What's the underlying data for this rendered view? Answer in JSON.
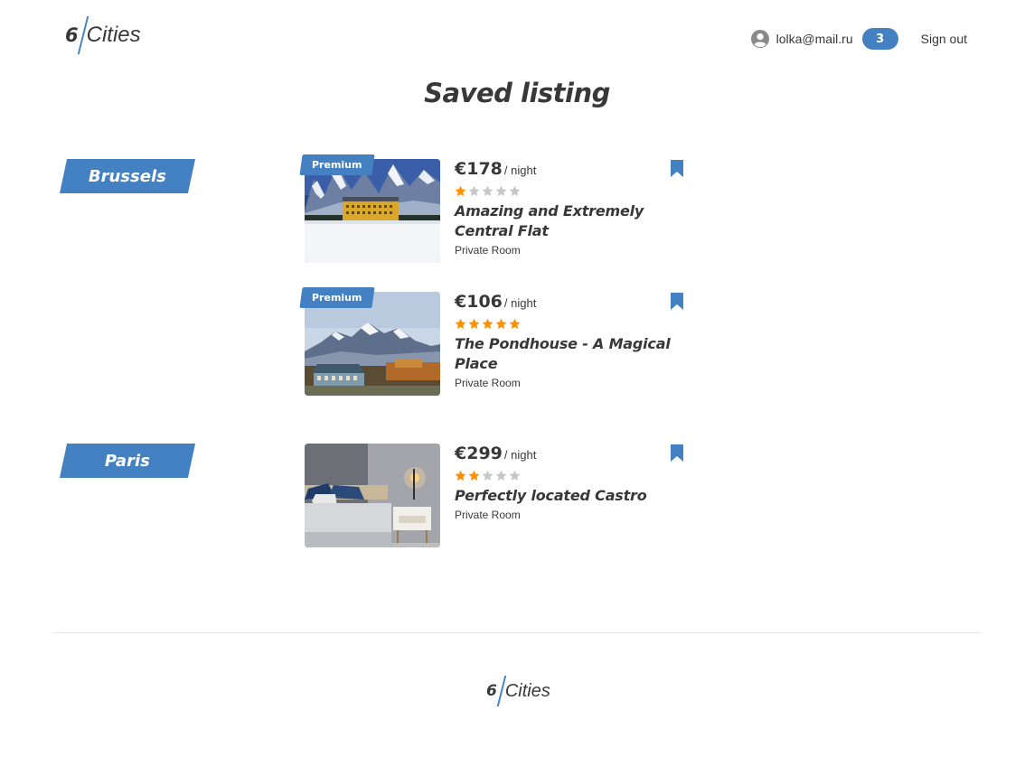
{
  "header": {
    "logo_six": "6",
    "logo_cities": "Cities",
    "user_email": "lolka@mail.ru",
    "favorites_count": "3",
    "sign_out": "Sign out"
  },
  "page": {
    "title": "Saved listing"
  },
  "colors": {
    "accent": "#4481c3",
    "star_active": "#ff9000",
    "star_inactive": "#c7c7c7",
    "text": "#383838"
  },
  "groups": [
    {
      "city": "Brussels",
      "cards": [
        {
          "premium_label": "Premium",
          "price": "€178",
          "per_night": "/ night",
          "rating": 1,
          "name": "Amazing and Extremely Central Flat",
          "type": "Private Room",
          "image": "mountain-hotel-snow"
        },
        {
          "premium_label": "Premium",
          "price": "€106",
          "per_night": "/ night",
          "rating": 5,
          "name": "The Pondhouse - A Magical Place",
          "type": "Private Room",
          "image": "mountain-house-autumn"
        }
      ]
    },
    {
      "city": "Paris",
      "cards": [
        {
          "price": "€299",
          "per_night": "/ night",
          "rating": 2,
          "name": "Perfectly located Castro",
          "type": "Private Room",
          "image": "bedroom-interior"
        }
      ]
    }
  ],
  "footer": {
    "logo_six": "6",
    "logo_cities": "Cities"
  }
}
